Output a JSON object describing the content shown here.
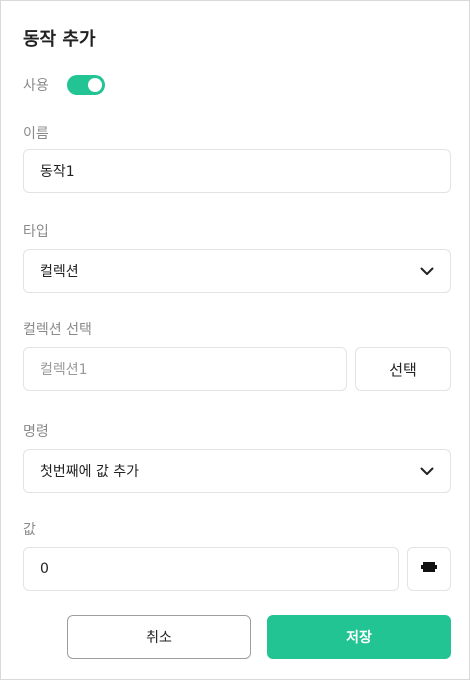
{
  "dialog": {
    "title": "동작 추가"
  },
  "enabled": {
    "label": "사용",
    "on": true,
    "color": "#22c493"
  },
  "name": {
    "label": "이름",
    "value": "동작1"
  },
  "type": {
    "label": "타입",
    "value": "컬렉션"
  },
  "collection": {
    "label": "컬렉션 선택",
    "placeholder": "컬렉션1",
    "select_button": "선택"
  },
  "command": {
    "label": "명령",
    "value": "첫번째에 값 추가"
  },
  "value_field": {
    "label": "값",
    "value": "0",
    "icon": "puzzle-block-icon"
  },
  "footer": {
    "cancel_label": "취소",
    "save_label": "저장"
  }
}
